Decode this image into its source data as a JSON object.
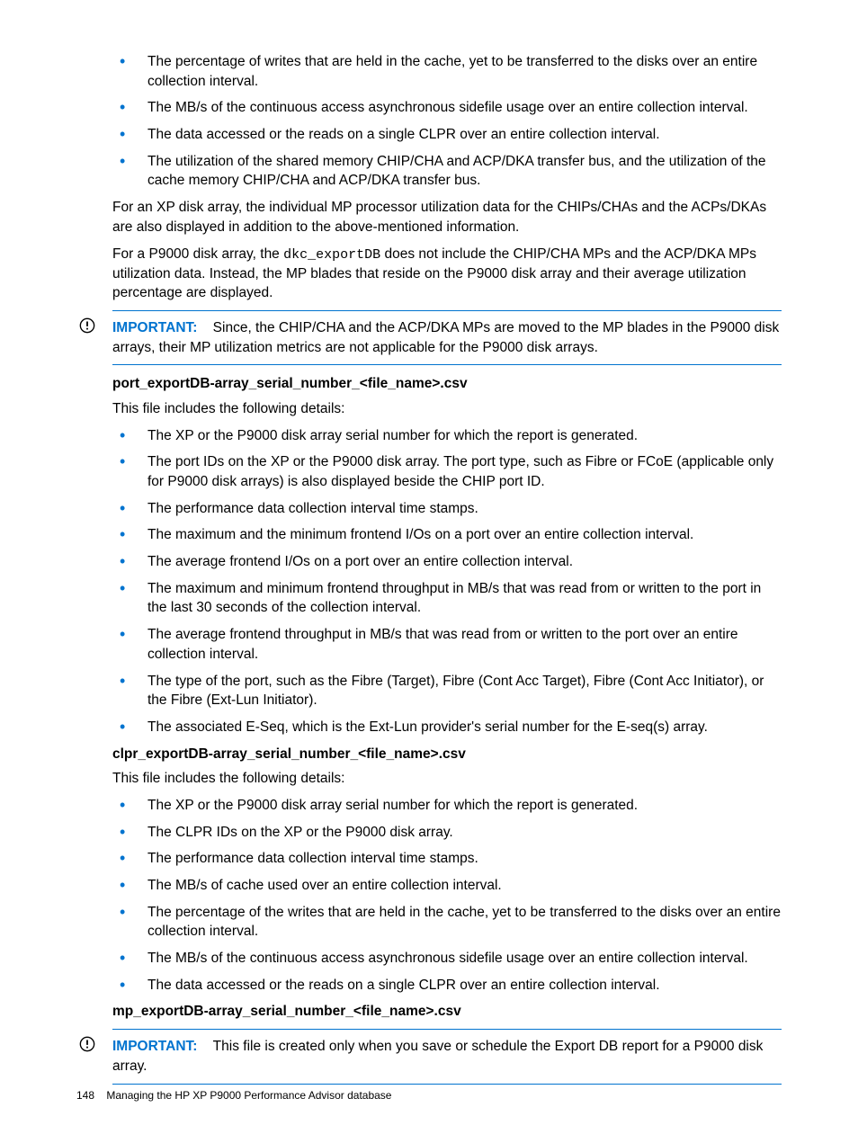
{
  "top_bullets": [
    "The percentage of writes that are held in the cache, yet to be transferred to the disks over an entire collection interval.",
    "The MB/s of the continuous access asynchronous sidefile usage over an entire collection interval.",
    "The data accessed or the reads on a single CLPR over an entire collection interval.",
    "The utilization of the shared memory CHIP/CHA and ACP/DKA transfer bus, and the utilization of the cache memory CHIP/CHA and ACP/DKA transfer bus."
  ],
  "para1": "For an XP disk array, the individual MP processor utilization data for the CHIPs/CHAs and the ACPs/DKAs are also displayed in addition to the above-mentioned information.",
  "para2_a": "For a P9000 disk array, the ",
  "para2_code": "dkc_exportDB",
  "para2_b": " does not include the CHIP/CHA MPs and the ACP/DKA MPs utilization data. Instead, the MP blades that reside on the P9000 disk array and their average utilization percentage are displayed.",
  "important1": {
    "label": "IMPORTANT:",
    "text": "Since, the CHIP/CHA and the ACP/DKA MPs are moved to the MP blades in the P9000 disk arrays, their MP utilization metrics are not applicable for the P9000 disk arrays."
  },
  "section1": {
    "heading": "port_exportDB-array_serial_number_<file_name>.csv",
    "intro": "This file includes the following details:",
    "bullets": [
      "The XP or the P9000 disk array serial number for which the report is generated.",
      "The port IDs on the XP or the P9000 disk array. The port type, such as Fibre or FCoE (applicable only for P9000 disk arrays) is also displayed beside the CHIP port ID.",
      "The performance data collection interval time stamps.",
      "The maximum and the minimum frontend I/Os on a port over an entire collection interval.",
      "The average frontend I/Os on a port over an entire collection interval.",
      "The maximum and minimum frontend throughput in MB/s that was read from or written to the port in the last 30 seconds of the collection interval.",
      "The average frontend throughput in MB/s that was read from or written to the port over an entire collection interval.",
      "The type of the port, such as the Fibre (Target), Fibre (Cont Acc Target), Fibre (Cont Acc Initiator), or the Fibre (Ext-Lun Initiator).",
      "The associated E-Seq, which is the Ext-Lun provider's serial number for the E-seq(s) array."
    ]
  },
  "section2": {
    "heading": "clpr_exportDB-array_serial_number_<file_name>.csv",
    "intro": "This file includes the following details:",
    "bullets": [
      "The XP or the P9000 disk array serial number for which the report is generated.",
      "The CLPR IDs on the XP or the P9000 disk array.",
      "The performance data collection interval time stamps.",
      "The MB/s of cache used over an entire collection interval.",
      "The percentage of the writes that are held in the cache, yet to be transferred to the disks over an entire collection interval.",
      "The MB/s of the continuous access asynchronous sidefile usage over an entire collection interval.",
      "The data accessed or the reads on a single CLPR over an entire collection interval."
    ]
  },
  "section3": {
    "heading": "mp_exportDB-array_serial_number_<file_name>.csv"
  },
  "important2": {
    "label": "IMPORTANT:",
    "text": "This file is created only when you save or schedule the Export DB report for a P9000 disk array."
  },
  "footer": {
    "page": "148",
    "title": "Managing the HP XP P9000 Performance Advisor database"
  }
}
